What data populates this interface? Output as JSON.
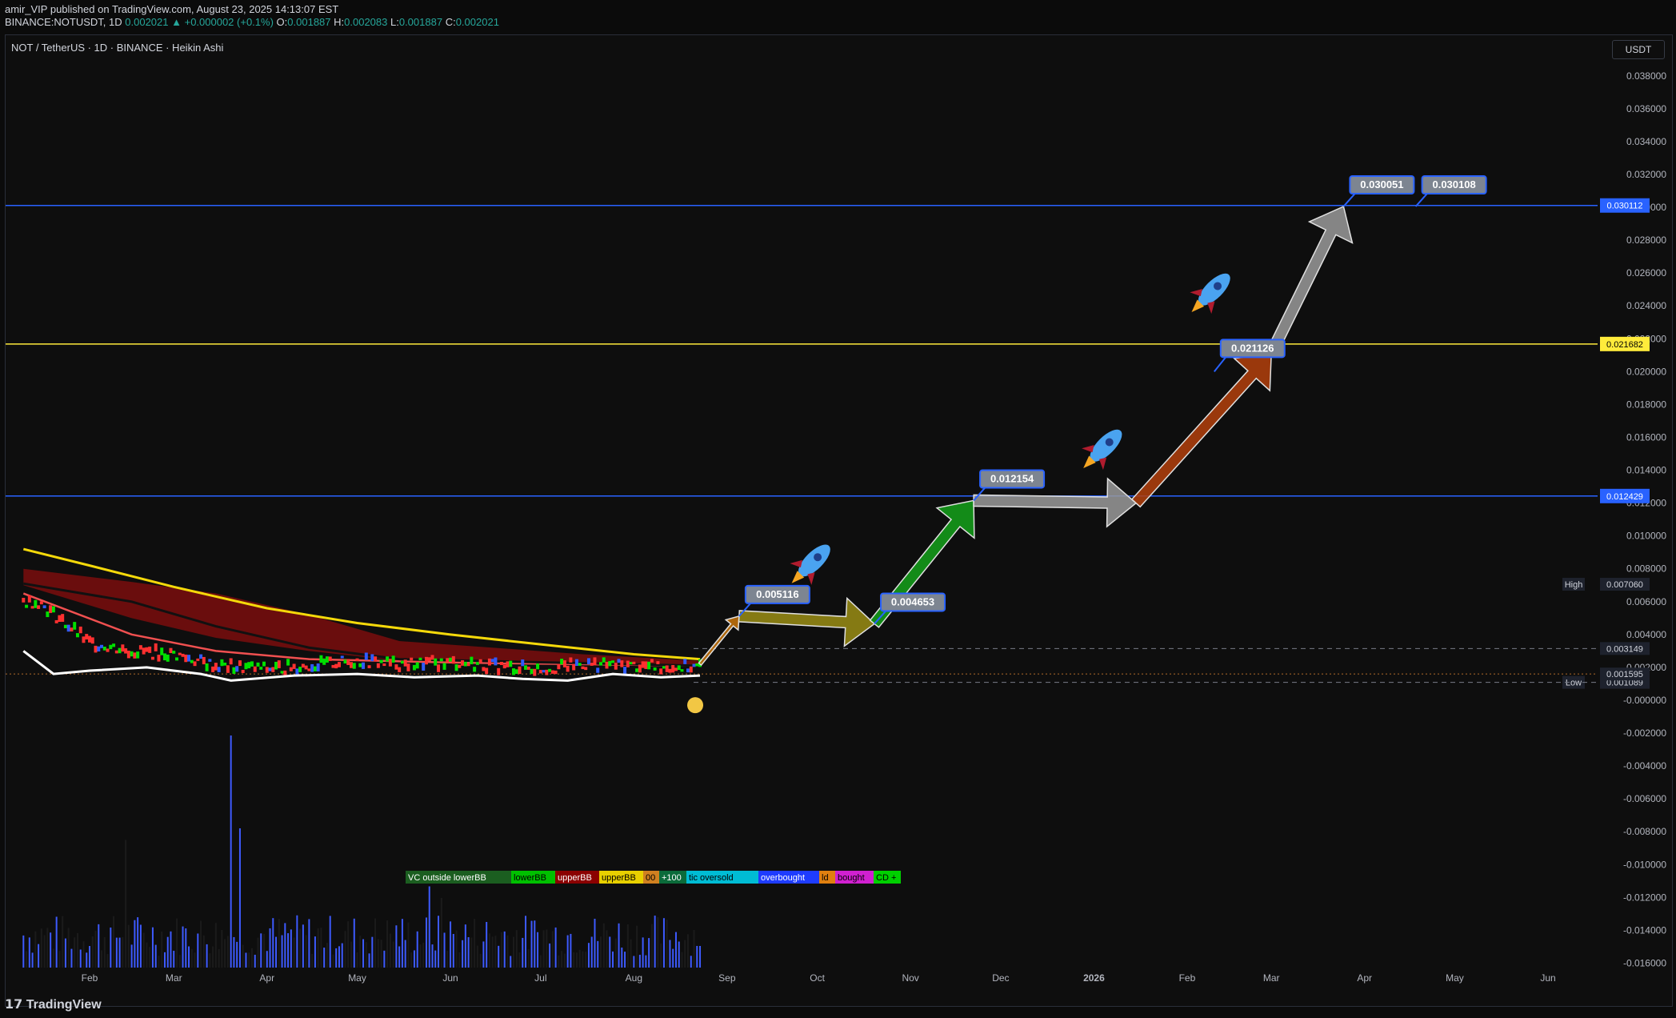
{
  "header": {
    "published_line": "amir_VIP published on TradingView.com, August 23, 2025 14:13:07 EST",
    "symbol_code": "BINANCE:NOTUSDT, 1D",
    "last": "0.002021",
    "change": "▲ +0.000002 (+0.1%)",
    "o_label": "O:",
    "o": "0.001887",
    "h_label": "H:",
    "h": "0.002083",
    "l_label": "L:",
    "l": "0.001887",
    "c_label": "C:",
    "c": "0.002021"
  },
  "chart_title": "NOT / TetherUS · 1D · BINANCE · Heikin Ashi",
  "currency_button": "USDT",
  "footer_brand": "TradingView",
  "colors": {
    "background": "#0e0e0e",
    "blue_line": "#2962ff",
    "yellow_line": "#ffeb3b",
    "yellow_ma": "#f5d90a",
    "red_ma": "#f05050",
    "volume": "#3d5afe"
  },
  "chart_data": {
    "type": "line",
    "y_ticks": [
      "0.038000",
      "0.036000",
      "0.034000",
      "0.032000",
      "0.030000",
      "0.028000",
      "0.026000",
      "0.024000",
      "0.022000",
      "0.020000",
      "0.018000",
      "0.016000",
      "0.014000",
      "0.012000",
      "0.010000",
      "0.008000",
      "0.006000",
      "0.004000",
      "0.002000",
      "-0.000000",
      "-0.002000",
      "-0.004000",
      "-0.006000",
      "-0.008000",
      "-0.010000",
      "-0.012000",
      "-0.014000",
      "-0.016000"
    ],
    "x_ticks": [
      "Feb",
      "Mar",
      "Apr",
      "May",
      "Jun",
      "Jul",
      "Aug",
      "Sep",
      "Oct",
      "Nov",
      "Dec",
      "2026",
      "Feb",
      "Mar",
      "Apr",
      "May",
      "Jun"
    ],
    "ylim": [
      -0.017,
      0.0395
    ],
    "horizontal_lines": [
      {
        "value": 0.030112,
        "label": "0.030112",
        "color": "#2962ff"
      },
      {
        "value": 0.021682,
        "label": "0.021682",
        "color": "#ffeb3b"
      },
      {
        "value": 0.012429,
        "label": "0.012429",
        "color": "#2962ff"
      }
    ],
    "price_labels": [
      {
        "name": "High",
        "value": 0.00706,
        "text": "0.007060"
      },
      {
        "name": "",
        "value": 0.003149,
        "text": "0.003149"
      },
      {
        "name": "Low",
        "value": 0.001089,
        "text": "0.001089"
      },
      {
        "name": "",
        "value": 0.001595,
        "text": "0.001595"
      }
    ],
    "price_series": [
      {
        "date": "2025-01-15",
        "value": 0.006
      },
      {
        "date": "2025-02-01",
        "value": 0.0035
      },
      {
        "date": "2025-02-15",
        "value": 0.003
      },
      {
        "date": "2025-03-01",
        "value": 0.0028
      },
      {
        "date": "2025-03-15",
        "value": 0.0021
      },
      {
        "date": "2025-04-01",
        "value": 0.0019
      },
      {
        "date": "2025-04-15",
        "value": 0.0021
      },
      {
        "date": "2025-05-01",
        "value": 0.0024
      },
      {
        "date": "2025-05-15",
        "value": 0.0022
      },
      {
        "date": "2025-06-01",
        "value": 0.0023
      },
      {
        "date": "2025-06-15",
        "value": 0.0021
      },
      {
        "date": "2025-07-01",
        "value": 0.0019
      },
      {
        "date": "2025-07-15",
        "value": 0.0022
      },
      {
        "date": "2025-08-01",
        "value": 0.0021
      },
      {
        "date": "2025-08-23",
        "value": 0.002
      }
    ],
    "ma_series": [
      {
        "date": "2025-01-10",
        "value": 0.0092
      },
      {
        "date": "2025-02-01",
        "value": 0.0082
      },
      {
        "date": "2025-03-01",
        "value": 0.0069
      },
      {
        "date": "2025-04-01",
        "value": 0.0056
      },
      {
        "date": "2025-05-01",
        "value": 0.0047
      },
      {
        "date": "2025-06-01",
        "value": 0.004
      },
      {
        "date": "2025-07-01",
        "value": 0.0034
      },
      {
        "date": "2025-08-01",
        "value": 0.0028
      },
      {
        "date": "2025-08-23",
        "value": 0.0025
      }
    ],
    "projection": [
      {
        "date": "2025-08-23",
        "value": 0.0022
      },
      {
        "date": "2025-09-05",
        "value": 0.005116
      },
      {
        "date": "2025-10-20",
        "value": 0.004653
      },
      {
        "date": "2025-11-22",
        "value": 0.012154
      },
      {
        "date": "2026-01-15",
        "value": 0.012
      },
      {
        "date": "2026-03-01",
        "value": 0.021126
      },
      {
        "date": "2026-03-25",
        "value": 0.030051
      }
    ],
    "annotations": [
      "0.005116",
      "0.004653",
      "0.012154",
      "0.021126",
      "0.030051",
      "0.030108"
    ],
    "indicator_legend": [
      "VC outside lowerBB",
      "lowerBB",
      "upperBB",
      "upperBB",
      "00",
      "+100",
      "tic oversold",
      "overbought",
      "ld",
      "bought",
      "CD +"
    ],
    "volume_peaks": [
      {
        "date": "2025-02-13",
        "value": 0.55
      },
      {
        "date": "2025-03-20",
        "value": 1.0
      },
      {
        "date": "2025-03-23",
        "value": 0.6
      },
      {
        "date": "2025-05-25",
        "value": 0.35
      },
      {
        "date": "2025-05-29",
        "value": 0.3
      }
    ],
    "grid": false
  }
}
